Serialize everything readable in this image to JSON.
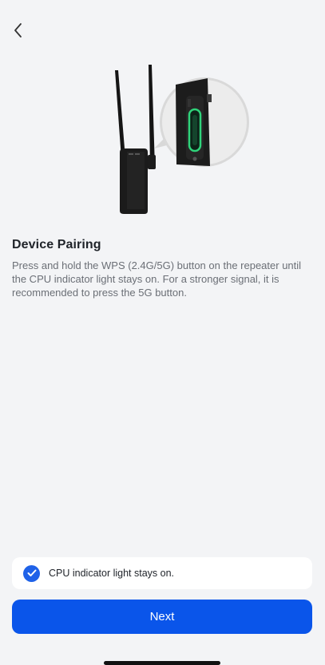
{
  "nav": {
    "back_icon": "chevron-left-icon"
  },
  "illustration": {
    "device": "repeater-with-two-antennas",
    "highlight": "wps-button-green-indicator",
    "accent_color": "#2fd37a"
  },
  "content": {
    "title": "Device Pairing",
    "description": "Press and hold the WPS (2.4G/5G) button on the repeater until the CPU indicator light stays on. For a stronger signal, it is recommended to press the 5G button."
  },
  "confirm": {
    "label": "CPU indicator light stays on.",
    "checked": true,
    "icon": "checkmark-icon",
    "color": "#1f62e8"
  },
  "actions": {
    "next_label": "Next",
    "color": "#0a55ea"
  }
}
